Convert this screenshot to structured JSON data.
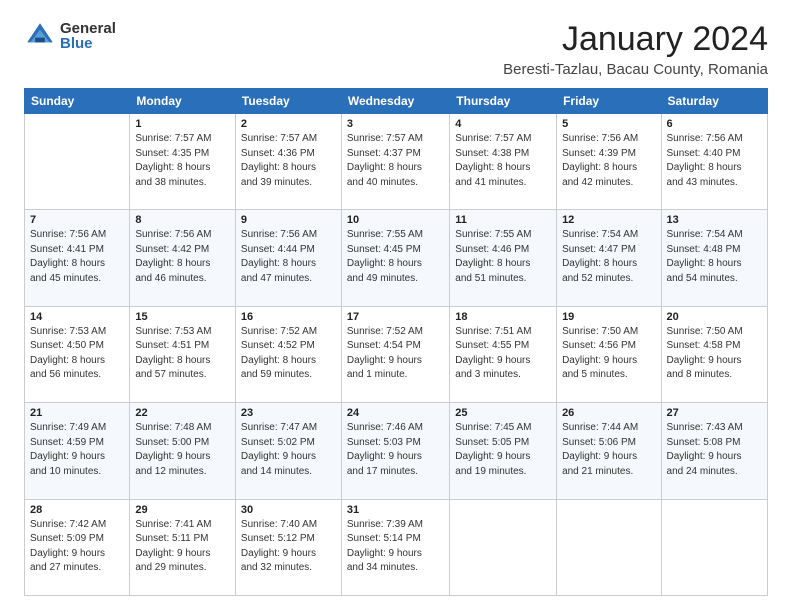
{
  "logo": {
    "general": "General",
    "blue": "Blue"
  },
  "header": {
    "month": "January 2024",
    "location": "Beresti-Tazlau, Bacau County, Romania"
  },
  "weekdays": [
    "Sunday",
    "Monday",
    "Tuesday",
    "Wednesday",
    "Thursday",
    "Friday",
    "Saturday"
  ],
  "weeks": [
    [
      {
        "day": "",
        "content": ""
      },
      {
        "day": "1",
        "content": "Sunrise: 7:57 AM\nSunset: 4:35 PM\nDaylight: 8 hours\nand 38 minutes."
      },
      {
        "day": "2",
        "content": "Sunrise: 7:57 AM\nSunset: 4:36 PM\nDaylight: 8 hours\nand 39 minutes."
      },
      {
        "day": "3",
        "content": "Sunrise: 7:57 AM\nSunset: 4:37 PM\nDaylight: 8 hours\nand 40 minutes."
      },
      {
        "day": "4",
        "content": "Sunrise: 7:57 AM\nSunset: 4:38 PM\nDaylight: 8 hours\nand 41 minutes."
      },
      {
        "day": "5",
        "content": "Sunrise: 7:56 AM\nSunset: 4:39 PM\nDaylight: 8 hours\nand 42 minutes."
      },
      {
        "day": "6",
        "content": "Sunrise: 7:56 AM\nSunset: 4:40 PM\nDaylight: 8 hours\nand 43 minutes."
      }
    ],
    [
      {
        "day": "7",
        "content": "Sunrise: 7:56 AM\nSunset: 4:41 PM\nDaylight: 8 hours\nand 45 minutes."
      },
      {
        "day": "8",
        "content": "Sunrise: 7:56 AM\nSunset: 4:42 PM\nDaylight: 8 hours\nand 46 minutes."
      },
      {
        "day": "9",
        "content": "Sunrise: 7:56 AM\nSunset: 4:44 PM\nDaylight: 8 hours\nand 47 minutes."
      },
      {
        "day": "10",
        "content": "Sunrise: 7:55 AM\nSunset: 4:45 PM\nDaylight: 8 hours\nand 49 minutes."
      },
      {
        "day": "11",
        "content": "Sunrise: 7:55 AM\nSunset: 4:46 PM\nDaylight: 8 hours\nand 51 minutes."
      },
      {
        "day": "12",
        "content": "Sunrise: 7:54 AM\nSunset: 4:47 PM\nDaylight: 8 hours\nand 52 minutes."
      },
      {
        "day": "13",
        "content": "Sunrise: 7:54 AM\nSunset: 4:48 PM\nDaylight: 8 hours\nand 54 minutes."
      }
    ],
    [
      {
        "day": "14",
        "content": "Sunrise: 7:53 AM\nSunset: 4:50 PM\nDaylight: 8 hours\nand 56 minutes."
      },
      {
        "day": "15",
        "content": "Sunrise: 7:53 AM\nSunset: 4:51 PM\nDaylight: 8 hours\nand 57 minutes."
      },
      {
        "day": "16",
        "content": "Sunrise: 7:52 AM\nSunset: 4:52 PM\nDaylight: 8 hours\nand 59 minutes."
      },
      {
        "day": "17",
        "content": "Sunrise: 7:52 AM\nSunset: 4:54 PM\nDaylight: 9 hours\nand 1 minute."
      },
      {
        "day": "18",
        "content": "Sunrise: 7:51 AM\nSunset: 4:55 PM\nDaylight: 9 hours\nand 3 minutes."
      },
      {
        "day": "19",
        "content": "Sunrise: 7:50 AM\nSunset: 4:56 PM\nDaylight: 9 hours\nand 5 minutes."
      },
      {
        "day": "20",
        "content": "Sunrise: 7:50 AM\nSunset: 4:58 PM\nDaylight: 9 hours\nand 8 minutes."
      }
    ],
    [
      {
        "day": "21",
        "content": "Sunrise: 7:49 AM\nSunset: 4:59 PM\nDaylight: 9 hours\nand 10 minutes."
      },
      {
        "day": "22",
        "content": "Sunrise: 7:48 AM\nSunset: 5:00 PM\nDaylight: 9 hours\nand 12 minutes."
      },
      {
        "day": "23",
        "content": "Sunrise: 7:47 AM\nSunset: 5:02 PM\nDaylight: 9 hours\nand 14 minutes."
      },
      {
        "day": "24",
        "content": "Sunrise: 7:46 AM\nSunset: 5:03 PM\nDaylight: 9 hours\nand 17 minutes."
      },
      {
        "day": "25",
        "content": "Sunrise: 7:45 AM\nSunset: 5:05 PM\nDaylight: 9 hours\nand 19 minutes."
      },
      {
        "day": "26",
        "content": "Sunrise: 7:44 AM\nSunset: 5:06 PM\nDaylight: 9 hours\nand 21 minutes."
      },
      {
        "day": "27",
        "content": "Sunrise: 7:43 AM\nSunset: 5:08 PM\nDaylight: 9 hours\nand 24 minutes."
      }
    ],
    [
      {
        "day": "28",
        "content": "Sunrise: 7:42 AM\nSunset: 5:09 PM\nDaylight: 9 hours\nand 27 minutes."
      },
      {
        "day": "29",
        "content": "Sunrise: 7:41 AM\nSunset: 5:11 PM\nDaylight: 9 hours\nand 29 minutes."
      },
      {
        "day": "30",
        "content": "Sunrise: 7:40 AM\nSunset: 5:12 PM\nDaylight: 9 hours\nand 32 minutes."
      },
      {
        "day": "31",
        "content": "Sunrise: 7:39 AM\nSunset: 5:14 PM\nDaylight: 9 hours\nand 34 minutes."
      },
      {
        "day": "",
        "content": ""
      },
      {
        "day": "",
        "content": ""
      },
      {
        "day": "",
        "content": ""
      }
    ]
  ]
}
